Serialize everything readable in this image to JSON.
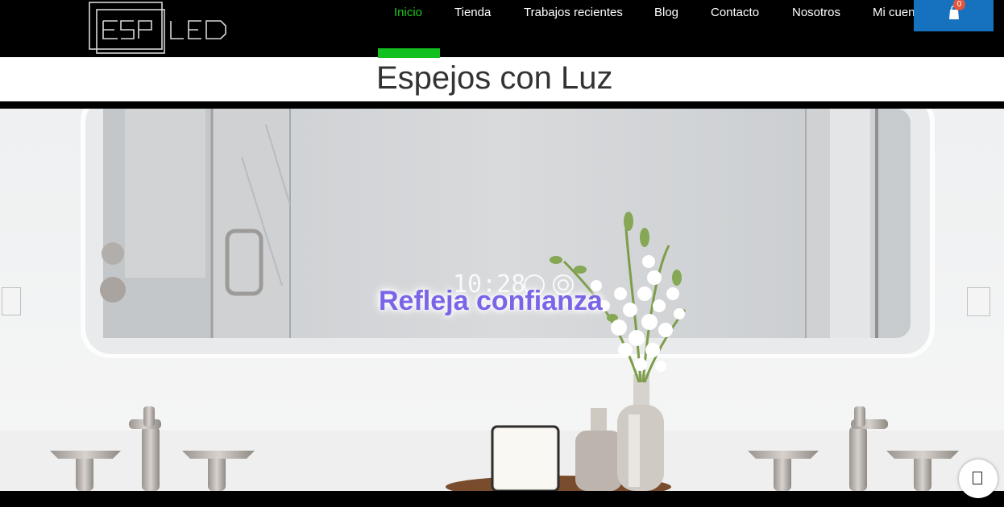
{
  "header": {
    "logo_text": "ESPLED",
    "nav": [
      {
        "label": "Inicio",
        "active": true
      },
      {
        "label": "Tienda"
      },
      {
        "label": "Trabajos recientes"
      },
      {
        "label": "Blog"
      },
      {
        "label": "Contacto"
      },
      {
        "label": "Nosotros"
      },
      {
        "label": "Mi cuenta"
      }
    ],
    "cart": {
      "icon": "shopping-bag-icon",
      "count": "0"
    }
  },
  "page": {
    "title": "Espejos con Luz"
  },
  "slider": {
    "caption": "Refleja confianza",
    "mirror_clock_text": "10:28",
    "prev_icon": "chevron-left-icon",
    "next_icon": "chevron-right-icon"
  },
  "chat": {
    "icon": "chat-icon"
  },
  "colors": {
    "header_bg": "#000000",
    "nav_active": "#22c41e",
    "nav_indicator": "#12c01f",
    "cart_bg": "#1671bf",
    "badge_bg": "#e0563e",
    "caption": "#7a65e8",
    "title_text": "#333333"
  }
}
